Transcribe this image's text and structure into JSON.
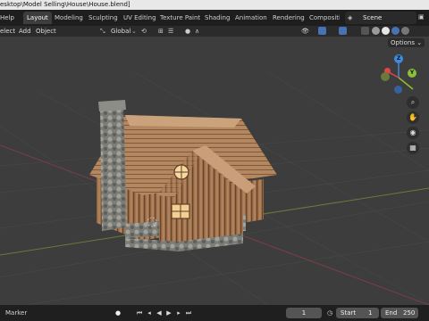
{
  "window": {
    "title": "esktop\\Model Selling\\House\\House.blend]"
  },
  "menubar": {
    "items": [
      "Help"
    ],
    "workspace_tabs": [
      "Layout",
      "Modeling",
      "Sculpting",
      "UV Editing",
      "Texture Paint",
      "Shading",
      "Animation",
      "Rendering",
      "Compositi"
    ],
    "active_tab": "Layout",
    "scene_label": "Scene"
  },
  "toolbar": {
    "menus": [
      "elect",
      "Add",
      "Object"
    ],
    "orientation": "Global",
    "options_label": "Options"
  },
  "viewport": {
    "gizmo": {
      "x": "X",
      "y": "Y",
      "z": "Z"
    }
  },
  "timeline": {
    "marker_label": "Marker",
    "current_frame": "1",
    "start_label": "Start",
    "start_value": "1",
    "end_label": "End",
    "end_value": "250"
  },
  "colors": {
    "accent": "#4772b3",
    "gizmo_x": "#e0454b",
    "gizmo_y": "#8bbe3a",
    "gizmo_z": "#3d8ce0"
  },
  "icons": [
    "cursor-icon",
    "move-icon",
    "transform-pivot-icon",
    "snap-icon",
    "proportional-icon",
    "view-layer-icon",
    "overlay-icon",
    "shading-icons",
    "zoom-icon",
    "hand-icon",
    "camera-icon",
    "grid-icon",
    "play-icon",
    "record-icon"
  ]
}
